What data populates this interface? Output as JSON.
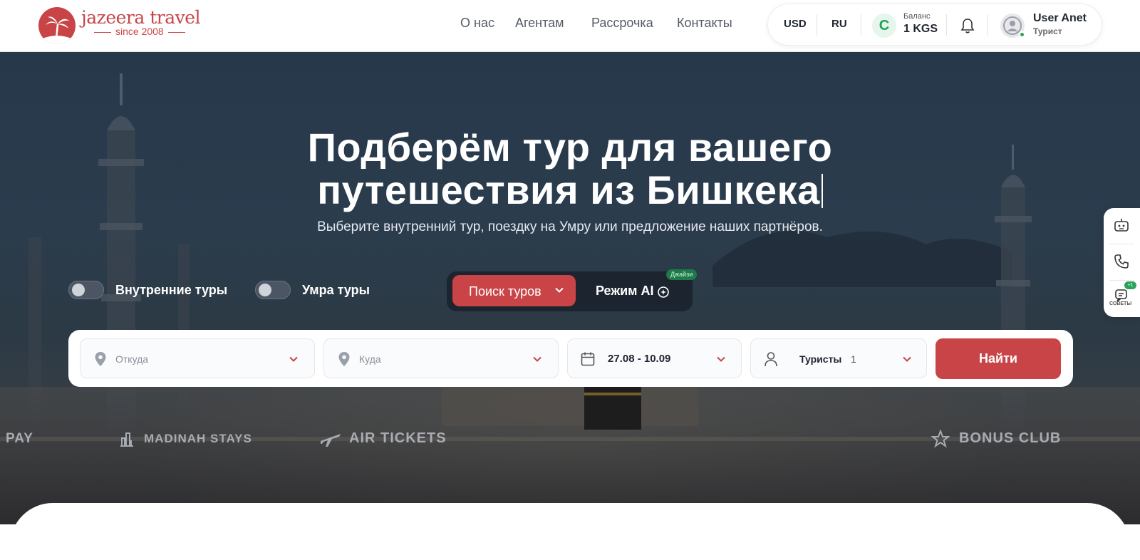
{
  "header": {
    "logo": {
      "name": "jazeera travel",
      "since": "since 2008"
    },
    "nav": [
      "О нас",
      "Агентам",
      "Рассрочка",
      "Контакты"
    ],
    "currency": "USD",
    "language": "RU",
    "balance": {
      "label": "Баланс",
      "value": "1 KGS",
      "icon": "som-currency-icon"
    },
    "user": {
      "name": "User Anet",
      "role": "Турист"
    }
  },
  "hero": {
    "title_line1": "Подберём тур для вашего",
    "title_line2": "путешествия из Бишкека",
    "subtitle": "Выберите внутренний тур, поездку на Умру или предложение наших партнёров.",
    "toggles": [
      {
        "label": "Внутренние туры",
        "on": false
      },
      {
        "label": "Умра туры",
        "on": false
      }
    ],
    "mode": {
      "search_label": "Поиск туров",
      "ai_label": "Режим AI",
      "ai_badge": "Джайзи"
    }
  },
  "search": {
    "from_placeholder": "Откуда",
    "to_placeholder": "Куда",
    "dates": "27.08 - 10.09",
    "tourists_label": "Туристы",
    "tourists_count": "1",
    "find_label": "Найти"
  },
  "partners": [
    "PAY",
    "MADINAH STAYS",
    "AIR TICKETS",
    "BONUS CLUB"
  ],
  "side_panel": {
    "badge": "+1",
    "tips_label": "СОВЕТЫ"
  },
  "colors": {
    "brand": "#c94446",
    "accent_green": "#21a35a"
  }
}
